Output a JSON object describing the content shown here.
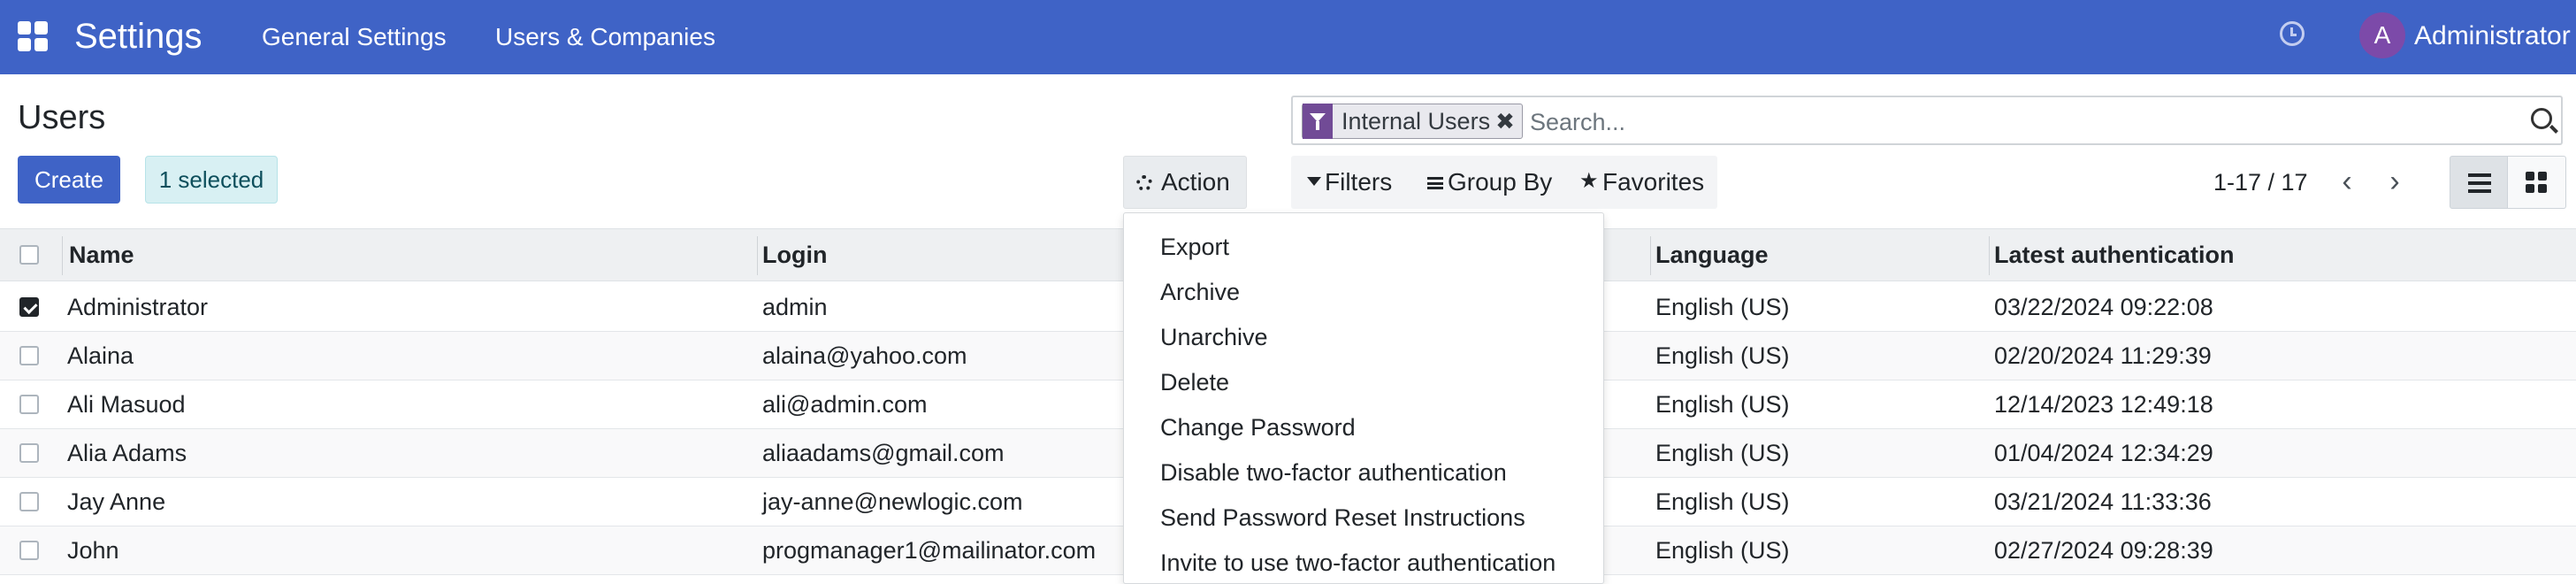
{
  "navbar": {
    "app_name": "Settings",
    "menus": [
      "General Settings",
      "Users & Companies"
    ],
    "avatar_initial": "A",
    "user_name": "Administrator",
    "color": "#3f63c6"
  },
  "control_panel": {
    "title": "Users",
    "create_label": "Create",
    "selected_label": "1 selected",
    "action_label": "Action",
    "search": {
      "facet_label": "Internal Users",
      "placeholder": "Search..."
    },
    "filters_label": "Filters",
    "groupby_label": "Group By",
    "favorites_label": "Favorites",
    "pager": "1-17 / 17"
  },
  "action_menu": {
    "items": [
      "Export",
      "Archive",
      "Unarchive",
      "Delete",
      "Change Password",
      "Disable two-factor authentication",
      "Send Password Reset Instructions",
      "Invite to use two-factor authentication"
    ]
  },
  "table": {
    "columns": [
      "Name",
      "Login",
      "Language",
      "Latest authentication"
    ],
    "rows": [
      {
        "name": "Administrator",
        "login": "admin",
        "language": "English (US)",
        "latest": "03/22/2024 09:22:08",
        "selected": true
      },
      {
        "name": "Alaina",
        "login": "alaina@yahoo.com",
        "language": "English (US)",
        "latest": "02/20/2024 11:29:39",
        "selected": false
      },
      {
        "name": "Ali Masuod",
        "login": "ali@admin.com",
        "language": "English (US)",
        "latest": "12/14/2023 12:49:18",
        "selected": false
      },
      {
        "name": "Alia Adams",
        "login": "aliaadams@gmail.com",
        "language": "English (US)",
        "latest": "01/04/2024 12:34:29",
        "selected": false
      },
      {
        "name": "Jay Anne",
        "login": "jay-anne@newlogic.com",
        "language": "English (US)",
        "latest": "03/21/2024 11:33:36",
        "selected": false
      },
      {
        "name": "John",
        "login": "progmanager1@mailinator.com",
        "language": "English (US)",
        "latest": "02/27/2024 09:28:39",
        "selected": false
      }
    ]
  }
}
